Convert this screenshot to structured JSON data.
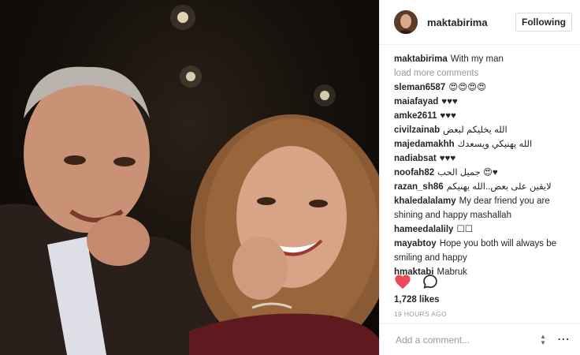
{
  "post": {
    "author": "maktabirima",
    "follow_label": "Following",
    "caption_user": "maktabirima",
    "caption_text": "With my man",
    "load_more": "load more comments",
    "likes": "1,728 likes",
    "time": "19 HOURS AGO",
    "add_comment_placeholder": "Add a comment..."
  },
  "comments": [
    {
      "user": "sleman6587",
      "text": "😍😍😍😍"
    },
    {
      "user": "maiafayad",
      "text": "♥♥♥"
    },
    {
      "user": "amke2611",
      "text": "♥♥♥"
    },
    {
      "user": "civilzainab",
      "text": "الله يخليكم لبعض"
    },
    {
      "user": "majedamakhh",
      "text": "الله يهنيكي ويسعدك"
    },
    {
      "user": "nadiabsat",
      "text": "♥♥♥"
    },
    {
      "user": "noofah82",
      "text": "جميل الحب 😍♥"
    },
    {
      "user": "razan_sh86",
      "text": "لايقين على بعض..الله يهنيكم"
    },
    {
      "user": "khaledalalamy",
      "text": "My dear friend you are shining and happy mashallah"
    },
    {
      "user": "hameedalalily",
      "text": "☐☐"
    },
    {
      "user": "mayabtoy",
      "text": "Hope you both will always be smiling and happy"
    },
    {
      "user": "hmaktabi",
      "text": "Mabruk"
    }
  ],
  "icons": {
    "like": "heart-icon",
    "comment": "comment-bubble-icon",
    "more": "more-options-icon"
  },
  "colors": {
    "like_red": "#ed4956",
    "username_text": "#262626",
    "muted_text": "#999999"
  }
}
